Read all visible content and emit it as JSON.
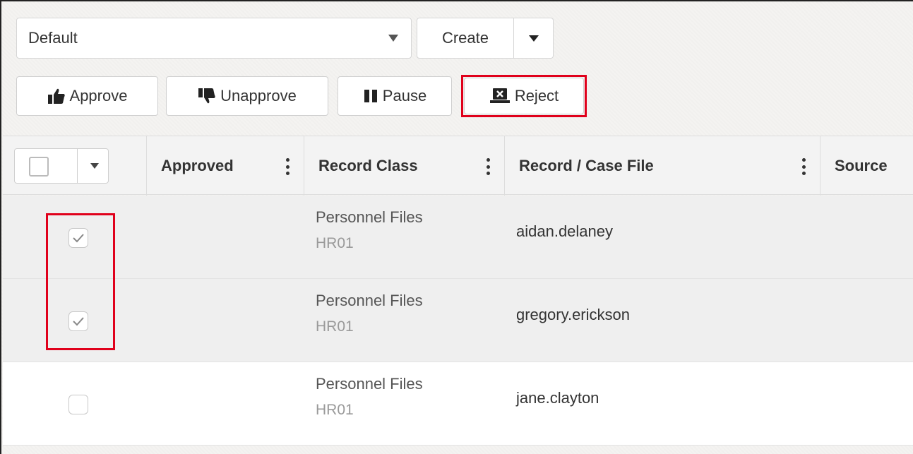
{
  "toolbar": {
    "view_select": {
      "value": "Default"
    },
    "create_label": "Create"
  },
  "actions": {
    "approve": "Approve",
    "unapprove": "Unapprove",
    "pause": "Pause",
    "reject": "Reject"
  },
  "table": {
    "columns": {
      "approved": "Approved",
      "record_class": "Record Class",
      "record_case_file": "Record / Case File",
      "source": "Source"
    },
    "rows": [
      {
        "checked": true,
        "record_class": "Personnel Files",
        "record_class_code": "HR01",
        "record": "aidan.delaney"
      },
      {
        "checked": true,
        "record_class": "Personnel Files",
        "record_class_code": "HR01",
        "record": "gregory.erickson"
      },
      {
        "checked": false,
        "record_class": "Personnel Files",
        "record_class_code": "HR01",
        "record": "jane.clayton"
      }
    ]
  },
  "colors": {
    "highlight": "#e0001b",
    "selected_row": "#efefef"
  }
}
